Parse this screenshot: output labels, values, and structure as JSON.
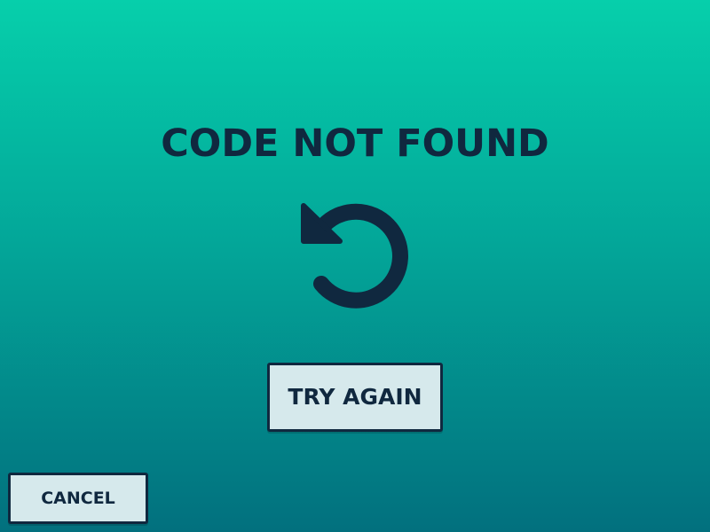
{
  "dialog": {
    "title": "CODE NOT FOUND",
    "icon": "retry-icon",
    "try_again_label": "TRY AGAIN",
    "cancel_label": "CANCEL"
  },
  "colors": {
    "background_top": "#06cfab",
    "background_bottom": "#02707e",
    "text": "#10283f",
    "button_fill": "#d6e9ec",
    "button_border": "#10283f"
  }
}
